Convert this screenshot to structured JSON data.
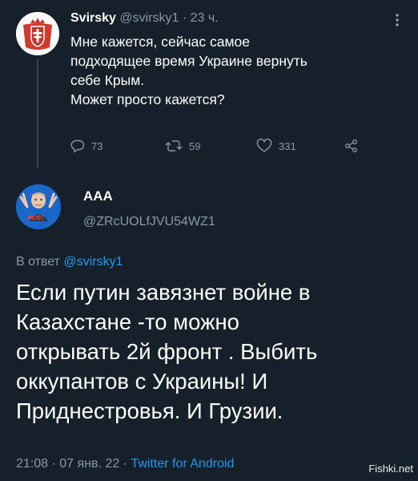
{
  "tweet": {
    "author_name": "Svirsky",
    "author_handle": "@svirsky1",
    "separator": "·",
    "time_ago": "23 ч.",
    "text_lines": [
      "Мне кажется, сейчас самое",
      "подходящее время Украине вернуть",
      "себе Крым.",
      "Может просто кажется?"
    ],
    "replies": "73",
    "retweets": "59",
    "likes": "331"
  },
  "reply": {
    "author_name": "ААА",
    "author_handle": "@ZRcUOLfJVU54WZ1",
    "reply_prefix": "В ответ",
    "reply_to": "@svirsky1",
    "text_lines": [
      "Если путин завязнет  войне в",
      "Казахстане -то можно",
      "открывать 2й фронт . Выбить",
      "оккупантов с Украины! И",
      "Приднестровья. И Грузии."
    ],
    "time": "21:08",
    "separator": "·",
    "date": "07 янв. 22",
    "separator2": "·",
    "client": "Twitter for Android",
    "avatar_caption": "все!"
  },
  "watermark": "Fishki.net",
  "icons": [
    "coat-of-arms-avatar",
    "more-icon",
    "reply-icon",
    "retweet-icon",
    "like-icon",
    "share-icon",
    "meme-avatar"
  ],
  "colors": {
    "background": "#15202b",
    "text": "#ffffff",
    "muted": "#8b98a5",
    "accent": "#1d9bf0"
  }
}
